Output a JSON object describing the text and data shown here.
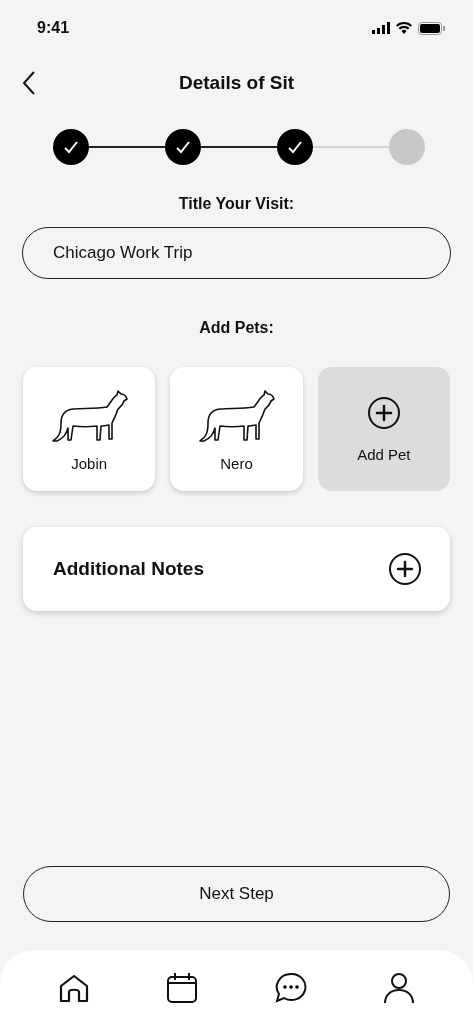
{
  "status_bar": {
    "time": "9:41"
  },
  "header": {
    "title": "Details of Sit"
  },
  "steps": [
    {
      "done": true
    },
    {
      "done": true
    },
    {
      "done": true
    },
    {
      "done": false
    }
  ],
  "title_field": {
    "label": "Title Your Visit:",
    "value": "Chicago Work Trip"
  },
  "pets": {
    "label": "Add Pets:",
    "items": [
      {
        "kind": "pet",
        "name": "Jobin"
      },
      {
        "kind": "pet",
        "name": "Nero"
      },
      {
        "kind": "add",
        "name": "Add Pet"
      }
    ]
  },
  "notes": {
    "label": "Additional Notes"
  },
  "next_button": {
    "label": "Next Step"
  },
  "tab_bar": [
    {
      "kind": "home"
    },
    {
      "kind": "calendar"
    },
    {
      "kind": "chat"
    },
    {
      "kind": "profile"
    }
  ]
}
